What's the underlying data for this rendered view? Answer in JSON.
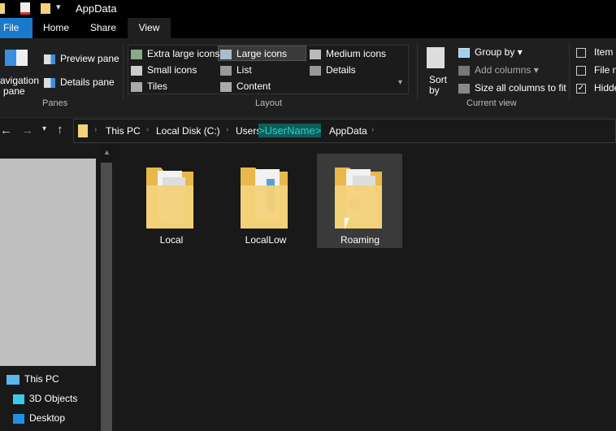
{
  "window": {
    "title": "AppData"
  },
  "tabs": [
    {
      "label": "File"
    },
    {
      "label": "Home"
    },
    {
      "label": "Share"
    },
    {
      "label": "View"
    }
  ],
  "ribbon": {
    "panes": {
      "navigation_pane": "avigation",
      "navigation_pane2": "pane",
      "preview_pane": "Preview pane",
      "details_pane": "Details pane",
      "group_label": "Panes"
    },
    "layout": {
      "items": [
        "Extra large icons",
        "Large icons",
        "Medium icons",
        "Small icons",
        "List",
        "Details",
        "Tiles",
        "Content"
      ],
      "selected": "Large icons",
      "group_label": "Layout"
    },
    "current_view": {
      "sort_by": "Sort",
      "sort_by2": "by",
      "group_by": "Group by",
      "add_columns": "Add columns",
      "size_columns": "Size all columns to fit",
      "group_label": "Current view"
    },
    "show_hide": {
      "item_checkboxes": "Item c",
      "file_name_ext": "File na",
      "hidden_items": "Hidde",
      "hidden_checked": true
    }
  },
  "address": {
    "crumbs": [
      "This PC",
      "Local Disk (C:)",
      "Users"
    ],
    "highlight": ">UserName>",
    "last": "AppData"
  },
  "nav": {
    "items": [
      "This PC",
      "3D Objects",
      "Desktop"
    ]
  },
  "folders": [
    {
      "name": "Local"
    },
    {
      "name": "LocalLow"
    },
    {
      "name": "Roaming",
      "selected": true
    }
  ],
  "colors": {
    "accent": "#1979ca",
    "highlight": "#0e5d5a",
    "folder": "#f3d27a"
  }
}
